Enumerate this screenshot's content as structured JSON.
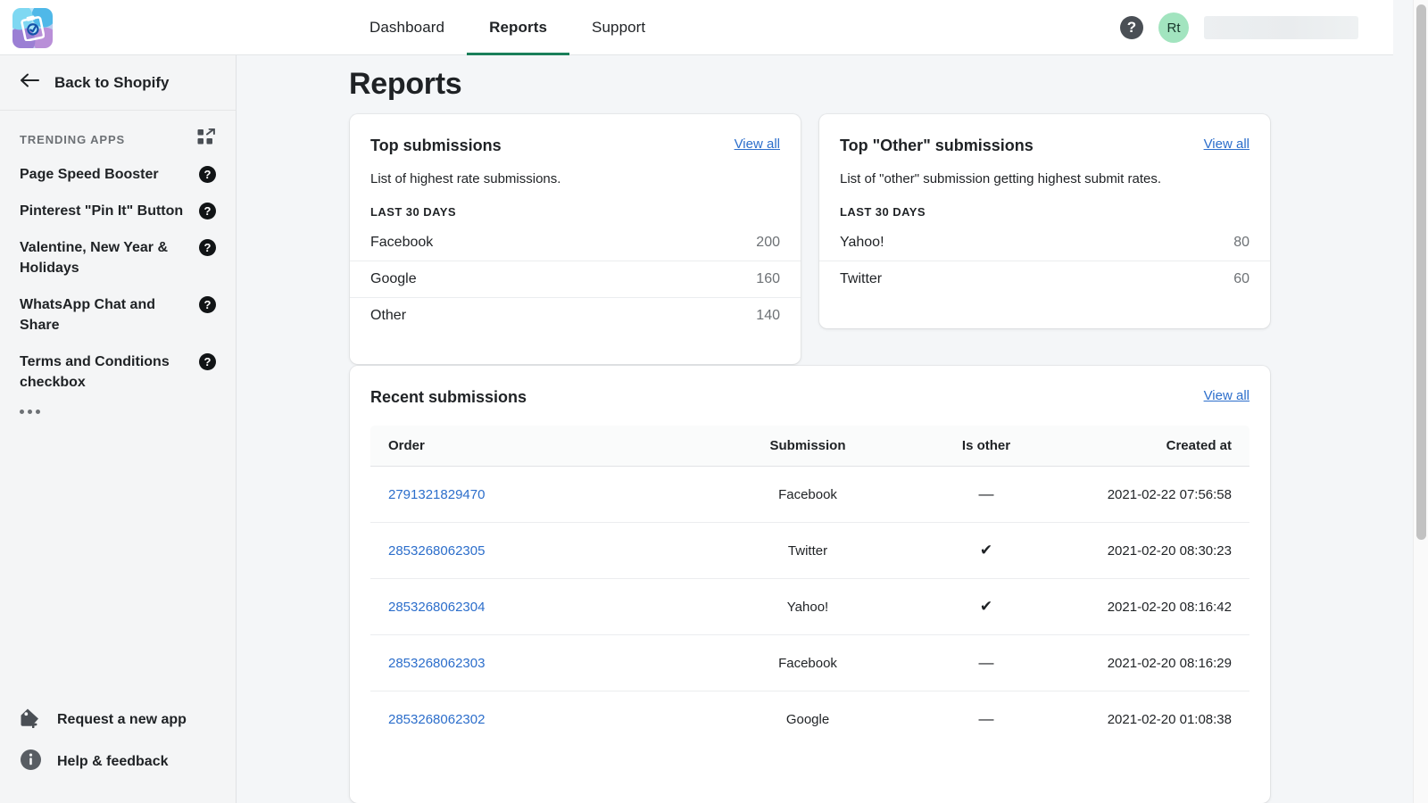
{
  "app": {
    "logo_icon": "clipboard-check-icon"
  },
  "topnav": {
    "items": [
      {
        "label": "Dashboard",
        "active": false
      },
      {
        "label": "Reports",
        "active": true
      },
      {
        "label": "Support",
        "active": false
      }
    ],
    "help_icon": "question-mark-icon",
    "help_glyph": "?",
    "avatar_initials": "Rt",
    "account_name_redacted": "",
    "active_accent": "#1a7f5a"
  },
  "sidebar": {
    "back": {
      "label": "Back to Shopify",
      "icon": "arrow-left-icon"
    },
    "section_title": "TRENDING APPS",
    "section_icon": "apps-grid-external-icon",
    "apps": [
      {
        "label": "Page Speed Booster"
      },
      {
        "label": "Pinterest \"Pin It\" Button"
      },
      {
        "label": "Valentine, New Year & Holidays"
      },
      {
        "label": "WhatsApp Chat and Share"
      },
      {
        "label": "Terms and Conditions checkbox"
      }
    ],
    "more_label": "•••",
    "bottom": [
      {
        "label": "Request a new app",
        "icon": "tag-plus-icon"
      },
      {
        "label": "Help & feedback",
        "icon": "info-circle-icon"
      }
    ]
  },
  "main": {
    "page_title": "Reports",
    "view_all_label": "View all",
    "cards": {
      "top_submissions": {
        "title": "Top submissions",
        "description": "List of highest rate submissions.",
        "period": "LAST 30 DAYS",
        "rows": [
          {
            "name": "Facebook",
            "value": "200"
          },
          {
            "name": "Google",
            "value": "160"
          },
          {
            "name": "Other",
            "value": "140"
          }
        ]
      },
      "top_other_submissions": {
        "title": "Top \"Other\" submissions",
        "description": "List of \"other\" submission getting highest submit rates.",
        "period": "LAST 30 DAYS",
        "rows": [
          {
            "name": "Yahoo!",
            "value": "80"
          },
          {
            "name": "Twitter",
            "value": "60"
          }
        ]
      },
      "recent_submissions": {
        "title": "Recent submissions",
        "columns": [
          "Order",
          "Submission",
          "Is other",
          "Created at"
        ],
        "rows": [
          {
            "order": "2791321829470",
            "submission": "Facebook",
            "is_other": "—",
            "created_at": "2021-02-22 07:56:58"
          },
          {
            "order": "2853268062305",
            "submission": "Twitter",
            "is_other": "✔",
            "created_at": "2021-02-20 08:30:23"
          },
          {
            "order": "2853268062304",
            "submission": "Yahoo!",
            "is_other": "✔",
            "created_at": "2021-02-20 08:16:42"
          },
          {
            "order": "2853268062303",
            "submission": "Facebook",
            "is_other": "—",
            "created_at": "2021-02-20 08:16:29"
          },
          {
            "order": "2853268062302",
            "submission": "Google",
            "is_other": "—",
            "created_at": "2021-02-20 01:08:38"
          }
        ]
      }
    }
  },
  "colors": {
    "link": "#2c6ecb",
    "accent_green": "#1a7f5a",
    "avatar_bg": "#a2e4bf",
    "page_bg": "#f4f6f8"
  }
}
